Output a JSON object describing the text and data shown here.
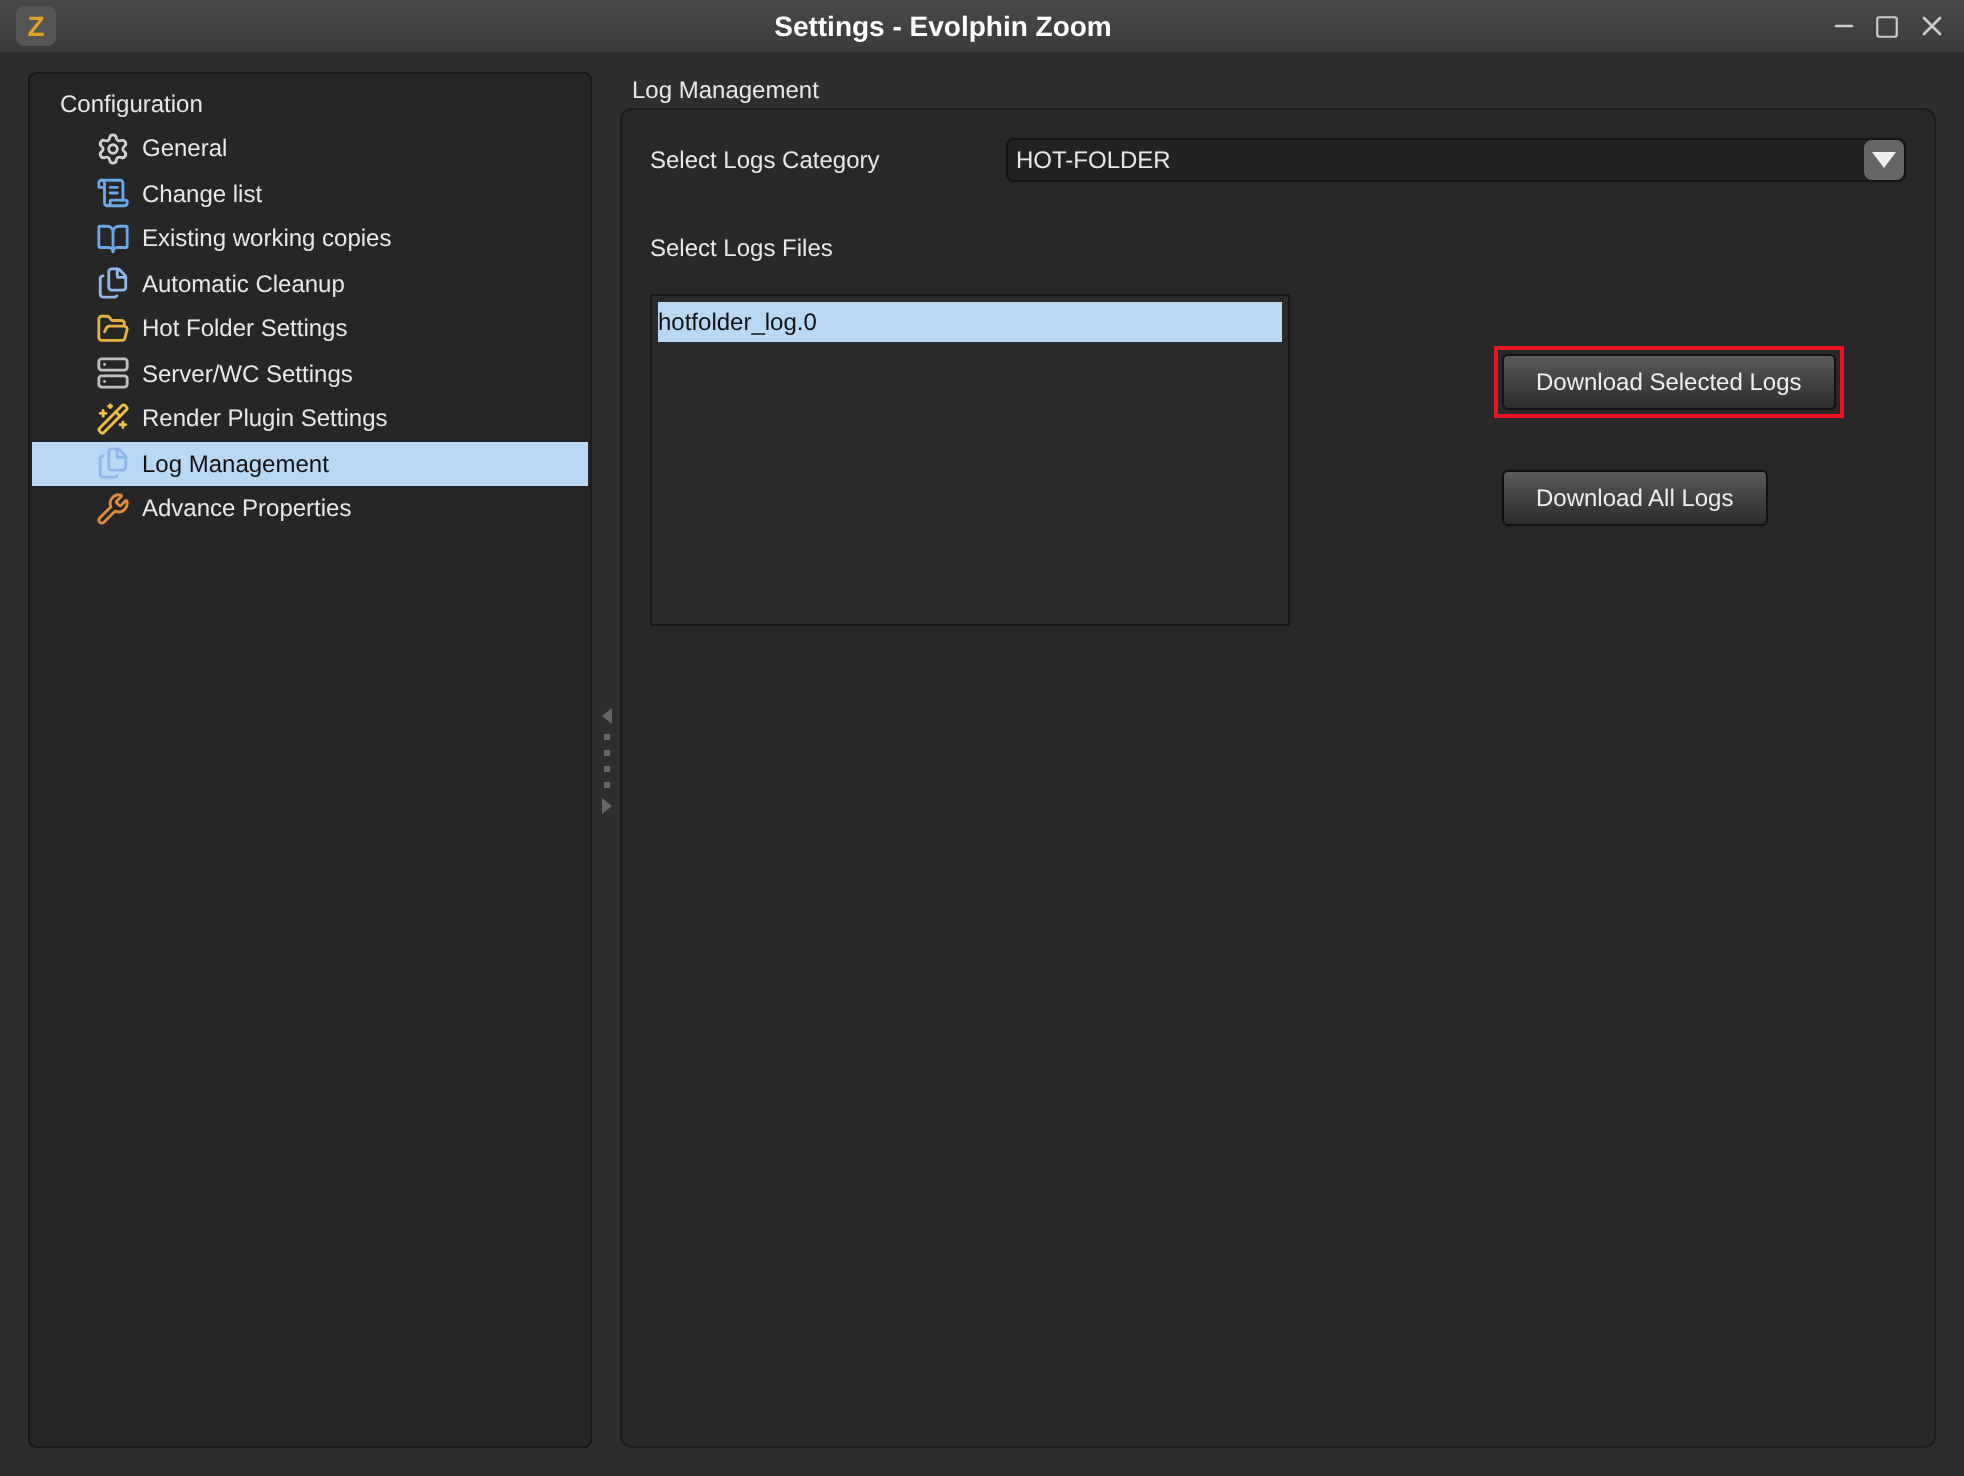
{
  "window": {
    "title": "Settings - Evolphin Zoom",
    "logo": "Z"
  },
  "sidebar": {
    "title": "Configuration",
    "items": [
      {
        "label": "General",
        "selected": false
      },
      {
        "label": "Change list",
        "selected": false
      },
      {
        "label": "Existing working copies",
        "selected": false
      },
      {
        "label": "Automatic Cleanup",
        "selected": false
      },
      {
        "label": "Hot Folder Settings",
        "selected": false
      },
      {
        "label": "Server/WC Settings",
        "selected": false
      },
      {
        "label": "Render Plugin Settings",
        "selected": false
      },
      {
        "label": "Log Management",
        "selected": true
      },
      {
        "label": "Advance Properties",
        "selected": false
      }
    ]
  },
  "panel": {
    "title": "Log Management",
    "category": {
      "label": "Select Logs Category",
      "value": "HOT-FOLDER"
    },
    "files": {
      "label": "Select Logs Files",
      "items": [
        {
          "label": "hotfolder_log.0",
          "selected": true
        }
      ]
    },
    "buttons": [
      {
        "label": "Download Selected Logs",
        "highlighted": true
      },
      {
        "label": "Download All Logs",
        "highlighted": false
      }
    ]
  }
}
